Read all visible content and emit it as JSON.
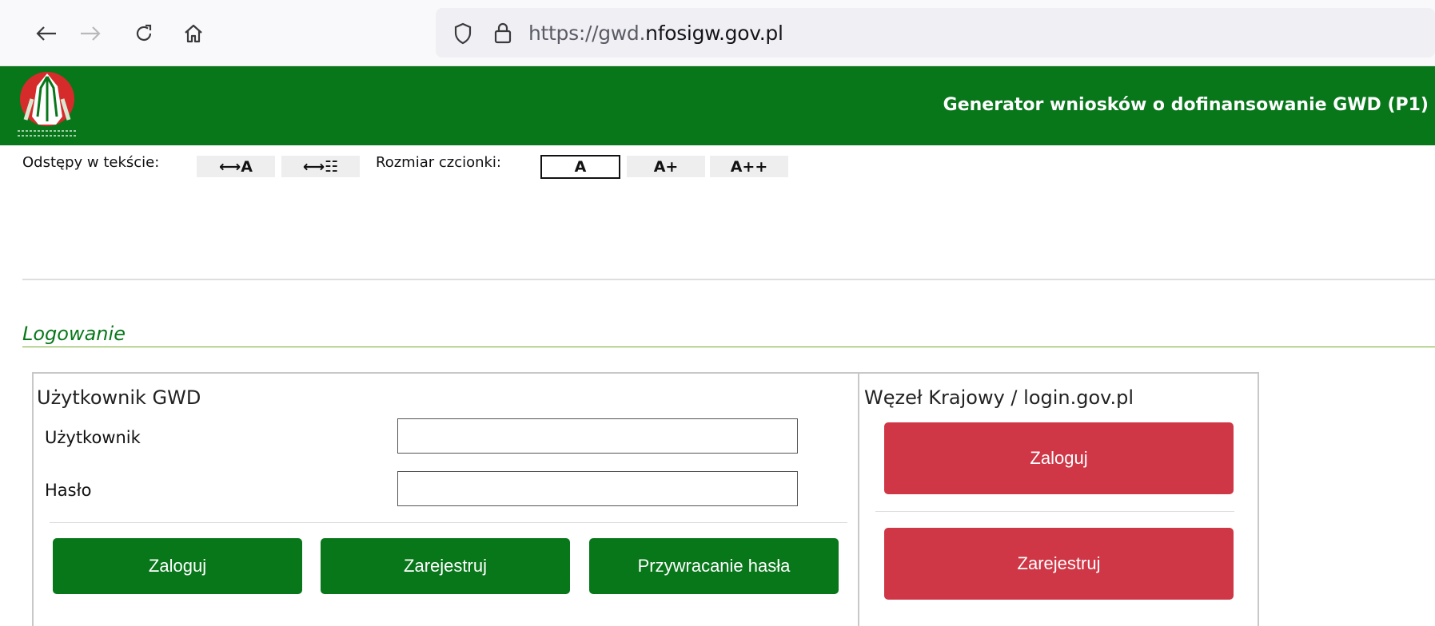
{
  "browser": {
    "url_prefix": "https://gwd.",
    "url_domain": "nfosigw.gov.pl",
    "icons": [
      "back-arrow-icon",
      "forward-arrow-icon",
      "reload-icon",
      "home-icon",
      "shield-icon",
      "lock-icon"
    ]
  },
  "header": {
    "title": "Generator wniosków o dofinansowanie GWD (P1)",
    "bg_color": "#07771a"
  },
  "toolbar": {
    "spacing_label": "Odstępy w tekście:",
    "letter_spacing_btn": "⟷A",
    "line_spacing_btn": "⟷☷",
    "font_size_label": "Rozmiar czcionki:",
    "font_sizes": [
      "A",
      "A+",
      "A++"
    ],
    "active_font_size": "A"
  },
  "section": {
    "title": "Logowanie"
  },
  "gwd_panel": {
    "heading": "Użytkownik GWD",
    "user_label": "Użytkownik",
    "user_value": "",
    "password_label": "Hasło",
    "password_value": "",
    "login_button": "Zaloguj",
    "register_button": "Zarejestruj",
    "reset_button": "Przywracanie hasła"
  },
  "national_panel": {
    "heading": "Węzeł Krajowy / login.gov.pl",
    "login_button": "Zaloguj",
    "register_button": "Zarejestruj",
    "button_color": "#cf3646"
  }
}
